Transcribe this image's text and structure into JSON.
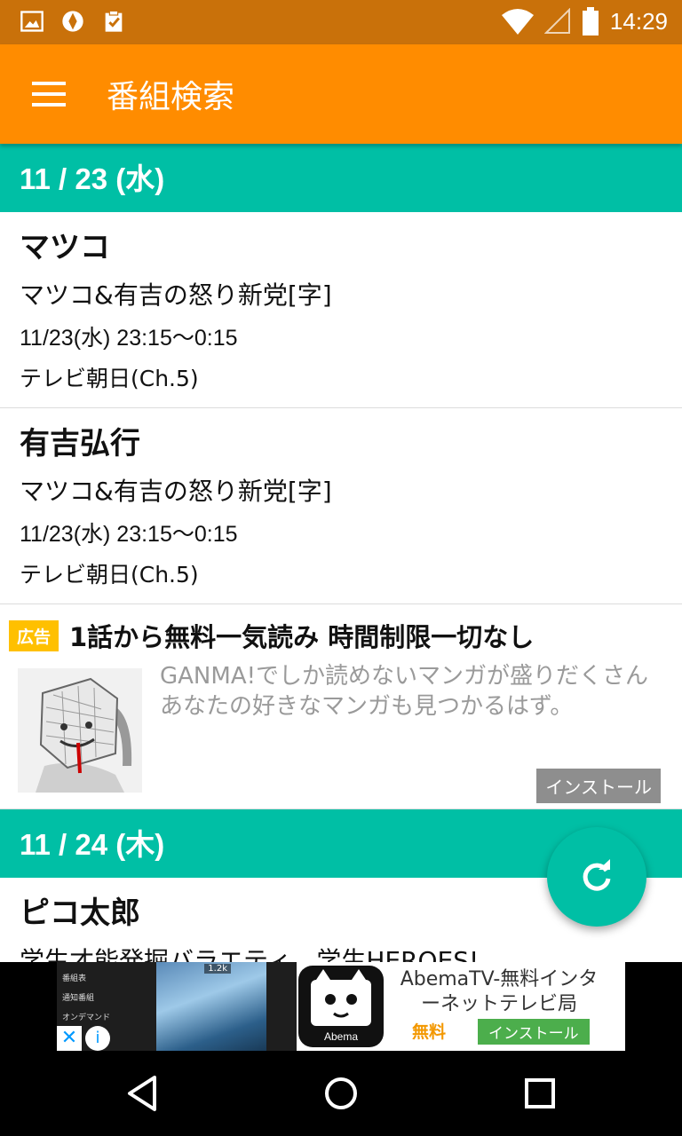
{
  "status_bar": {
    "time": "14:29",
    "icons_left": [
      "image-icon",
      "app-icon",
      "clipboard-check-icon"
    ],
    "icons_right": [
      "wifi-icon",
      "signal-icon",
      "battery-icon"
    ]
  },
  "app_bar": {
    "title": "番組検索",
    "menu_icon": "hamburger-menu-icon"
  },
  "colors": {
    "app_bar": "#ff8c00",
    "status_bar": "#c9710a",
    "date_header": "#00bfa5",
    "fab": "#00bfa5",
    "ad_badge": "#ffc000"
  },
  "sections": [
    {
      "date": "11 / 23 (水)",
      "items": [
        {
          "name": "マツコ",
          "title": "マツコ&有吉の怒り新党[字]",
          "time": "11/23(水) 23:15〜0:15",
          "channel": "テレビ朝日(Ch.5)"
        },
        {
          "name": "有吉弘行",
          "title": "マツコ&有吉の怒り新党[字]",
          "time": "11/23(水) 23:15〜0:15",
          "channel": "テレビ朝日(Ch.5)"
        }
      ]
    },
    {
      "date": "11 / 24 (木)",
      "items": [
        {
          "name": "ピコ太郎",
          "title": "学生才能発掘バラエティ　学生HEROES!"
        }
      ]
    }
  ],
  "ad": {
    "badge": "広告",
    "headline": "1話から無料一気読み 時間制限一切なし",
    "body": "GANMA!でしか読めないマンガが盛りだくさんあなたの好きなマンガも見つかるはず。",
    "install_label": "インストール"
  },
  "banner_ad": {
    "left_menu": [
      "番組表",
      "通知番組",
      "オンデマンド"
    ],
    "view_count": "1.2k",
    "title": "AbemaTV-無料インターネットテレビ局",
    "price": "無料",
    "install_label": "インストール",
    "logo_text": "Abema"
  },
  "fab": {
    "icon": "refresh-icon"
  },
  "nav_bar": {
    "icons": [
      "back-icon",
      "home-icon",
      "recents-icon"
    ]
  }
}
